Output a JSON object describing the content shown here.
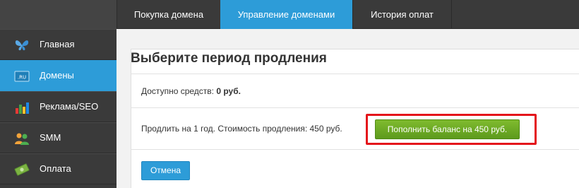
{
  "tabs": [
    {
      "label": "Покупка домена"
    },
    {
      "label": "Управление доменами"
    },
    {
      "label": "История оплат"
    }
  ],
  "sidebar": {
    "items": [
      {
        "label": "Главная",
        "icon": "butterfly-icon"
      },
      {
        "label": "Домены",
        "icon": "ru-domain-icon",
        "active": true
      },
      {
        "label": "Реклама/SEO",
        "icon": "bar-chart-icon"
      },
      {
        "label": "SMM",
        "icon": "users-icon"
      },
      {
        "label": "Оплата",
        "icon": "money-icon"
      }
    ]
  },
  "main": {
    "title": "Выберите период продления",
    "available_label": "Доступно средств:",
    "available_value": "0 руб.",
    "renew_text": "Продлить на 1 год. Стоимость продления: 450 руб.",
    "topup_button": "Пополнить баланс на 450 руб.",
    "cancel_button": "Отмена"
  },
  "colors": {
    "accent_blue": "#2d9cd8",
    "topup_green": "#6aaa25",
    "highlight_red": "#e4151b",
    "sidebar_bg": "#3a3a3a"
  }
}
